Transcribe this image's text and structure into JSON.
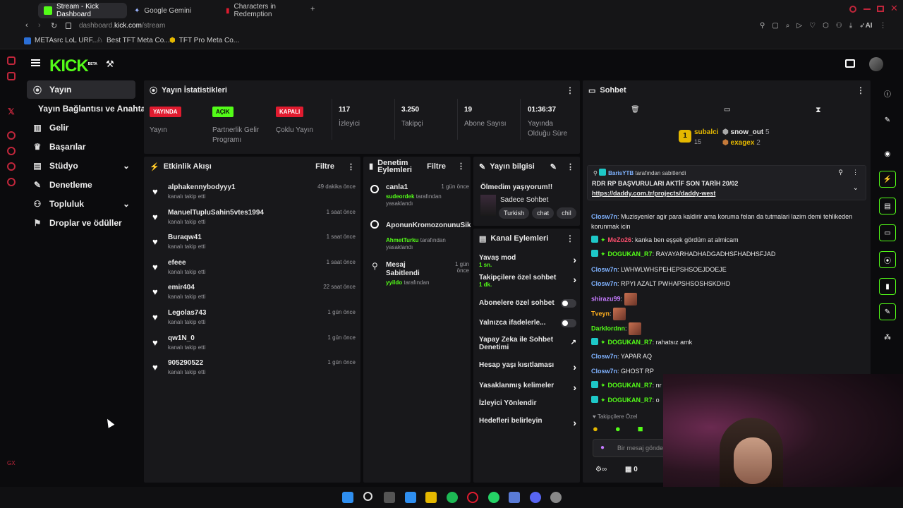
{
  "browser": {
    "tabs": [
      {
        "label": "Stream - Kick Dashboard",
        "active": true
      },
      {
        "label": "Google Gemini",
        "active": false
      },
      {
        "label": "Characters in Redemption",
        "active": false
      }
    ],
    "new_tab_icon": "plus-icon",
    "url_prefix": "dashboard.",
    "url_domain": "kick.com",
    "url_path": "/stream",
    "ai_label": "AI",
    "bookmarks": [
      "METAsrc LoL URF...",
      "Best TFT Meta Co...",
      "TFT Pro Meta Co..."
    ]
  },
  "kick": {
    "logo": "KICK",
    "beta": "BETA"
  },
  "nav": {
    "items": [
      {
        "label": "Yayın",
        "icon": "broadcast-icon",
        "active": true
      },
      {
        "label": "Yayın Bağlantısı ve Anahtarı",
        "icon": "",
        "active": false
      },
      {
        "label": "Gelir",
        "icon": "chart-icon",
        "active": false
      },
      {
        "label": "Başarılar",
        "icon": "trophy-icon",
        "active": false
      },
      {
        "label": "Stüdyo",
        "icon": "studio-icon",
        "active": false
      },
      {
        "label": "Denetleme",
        "icon": "wrench-icon",
        "active": false
      },
      {
        "label": "Topluluk",
        "icon": "people-icon",
        "active": false
      },
      {
        "label": "Droplar ve ödüller",
        "icon": "gift-icon",
        "active": false
      }
    ]
  },
  "stats": {
    "title": "Yayın İstatistikleri",
    "live_badge": "YAYINDA",
    "live_label": "Yayın",
    "partner_badge": "AÇIK",
    "partner_label": "Partnerlik Gelir Programı",
    "multi_badge": "KAPALI",
    "multi_label": "Çoklu Yayın",
    "viewers": "117",
    "viewers_label": "İzleyici",
    "followers": "3.250",
    "followers_label": "Takipçi",
    "subs": "19",
    "subs_label": "Abone Sayısı",
    "uptime": "01:36:37",
    "uptime_label": "Yayında Olduğu Süre"
  },
  "activity": {
    "title": "Etkinlik Akışı",
    "filter": "Filtre",
    "items": [
      {
        "name": "alphakennybodyyy1",
        "sub": "kanalı takip etti",
        "time": "49 dakika önce"
      },
      {
        "name": "ManuelTupluSahin5vtes1994",
        "sub": "kanalı takip etti",
        "time": "1 saat önce"
      },
      {
        "name": "Buraqw41",
        "sub": "kanalı takip etti",
        "time": "1 saat önce"
      },
      {
        "name": "efeee",
        "sub": "kanalı takip etti",
        "time": "1 saat önce"
      },
      {
        "name": "emir404",
        "sub": "kanalı takip etti",
        "time": "22 saat önce"
      },
      {
        "name": "Legolas743",
        "sub": "kanalı takip etti",
        "time": "1 gün önce"
      },
      {
        "name": "qw1N_0",
        "sub": "kanalı takip etti",
        "time": "1 gün önce"
      },
      {
        "name": "905290522",
        "sub": "kanalı takip etti",
        "time": "1 gün önce"
      }
    ]
  },
  "moderation": {
    "title": "Denetim Eylemleri",
    "filter": "Filtre",
    "items": [
      {
        "name": "canla1",
        "time": "1 gün önce",
        "by": "sudeordek",
        "suffix": "tarafından yasaklandı"
      },
      {
        "name": "AponunKromozonunuSik",
        "time": "",
        "by": "AhmetTurku",
        "suffix": "tarafından yasaklandı"
      },
      {
        "name": "Mesaj Sabitlendi",
        "time": "1 gün önce",
        "by": "yyildo",
        "suffix": "tarafından"
      }
    ]
  },
  "stream_info": {
    "title": "Yayın bilgisi",
    "stream_title": "Ölmedim yaşıyorum!!",
    "category": "Sadece Sohbet",
    "tags": [
      "Turkish",
      "chat",
      "chil"
    ]
  },
  "channel_actions": {
    "title": "Kanal Eylemleri",
    "items": [
      {
        "label": "Yavaş mod",
        "sub": "1 sn.",
        "control": "chevron"
      },
      {
        "label": "Takipçilere özel sohbet",
        "sub": "1 dk.",
        "control": "chevron"
      },
      {
        "label": "Abonelere özel sohbet",
        "sub": "",
        "control": "toggle"
      },
      {
        "label": "Yalnızca ifadelerle...",
        "sub": "",
        "control": "toggle"
      },
      {
        "label": "Yapay Zeka ile Sohbet Denetimi",
        "sub": "",
        "control": "external"
      },
      {
        "label": "Hesap yaşı kısıtlaması",
        "sub": "",
        "control": "chevron"
      },
      {
        "label": "Yasaklanmış kelimeler",
        "sub": "",
        "control": "chevron"
      },
      {
        "label": "İzleyici Yönlendir",
        "sub": "",
        "control": "none"
      },
      {
        "label": "Hedefleri belirleyin",
        "sub": "",
        "control": "chevron"
      }
    ]
  },
  "chat": {
    "title": "Sohbet",
    "leaderboard": [
      {
        "name": "subalci",
        "count": "15",
        "rank": "1"
      },
      {
        "name": "snow_out",
        "count": "5"
      },
      {
        "name": "exagex",
        "count": "2"
      }
    ],
    "pinned_by": "BarisYTB",
    "pinned_suffix": "tarafından sabitlendi",
    "pinned_text": "RDR RP BAŞVURULARI AKTİF SON TARİH 20/02",
    "pinned_link": "https://daddy.com.tr/projects/daddy-west",
    "messages": [
      {
        "user": "Closw7n",
        "color": "#7fb2ff",
        "text": "Muzisyenler agir para kaldirir ama koruma felan da tutmalari lazim demi tehlikeden korunmak icin",
        "badges": false
      },
      {
        "user": "MeZo26",
        "color": "#ff4f6e",
        "text": "kanka ben eşşek gördüm at almicam",
        "badges": true
      },
      {
        "user": "DOGUKAN_R7",
        "color": "#53fc18",
        "text": "RAYAYARHADHADGADHSFHADHSFJAD",
        "badges": true
      },
      {
        "user": "Closw7n",
        "color": "#7fb2ff",
        "text": "LWHWLWHSPEHEPSHSOEJDOEJE",
        "badges": false
      },
      {
        "user": "Closw7n",
        "color": "#7fb2ff",
        "text": "RPYI AZALT PWHAPSHSOSHSKDHD",
        "badges": false
      },
      {
        "user": "shirazu99",
        "color": "#c57bff",
        "text": "",
        "badges": false,
        "emote": true
      },
      {
        "user": "Tveyn",
        "color": "#ffb020",
        "text": "",
        "badges": false,
        "emote": true
      },
      {
        "user": "Darklordnn",
        "color": "#53fc18",
        "text": "",
        "badges": false,
        "emote": true
      },
      {
        "user": "DOGUKAN_R7",
        "color": "#53fc18",
        "text": "rahatsız amk",
        "badges": true
      },
      {
        "user": "Closw7n",
        "color": "#7fb2ff",
        "text": "YAPAR AQ",
        "badges": false
      },
      {
        "user": "Closw7n",
        "color": "#7fb2ff",
        "text": "GHOST RP",
        "badges": false
      },
      {
        "user": "DOGUKAN_R7",
        "color": "#53fc18",
        "text": "nr",
        "badges": true
      },
      {
        "user": "DOGUKAN_R7",
        "color": "#53fc18",
        "text": "o",
        "badges": true
      }
    ],
    "followers_only": "Takipçilere Özel",
    "input_placeholder": "Bir mesaj gönde",
    "points": "0"
  },
  "colors": {
    "accent": "#53fc18",
    "badge_red": "#e01b2f",
    "panel": "#18181b"
  }
}
